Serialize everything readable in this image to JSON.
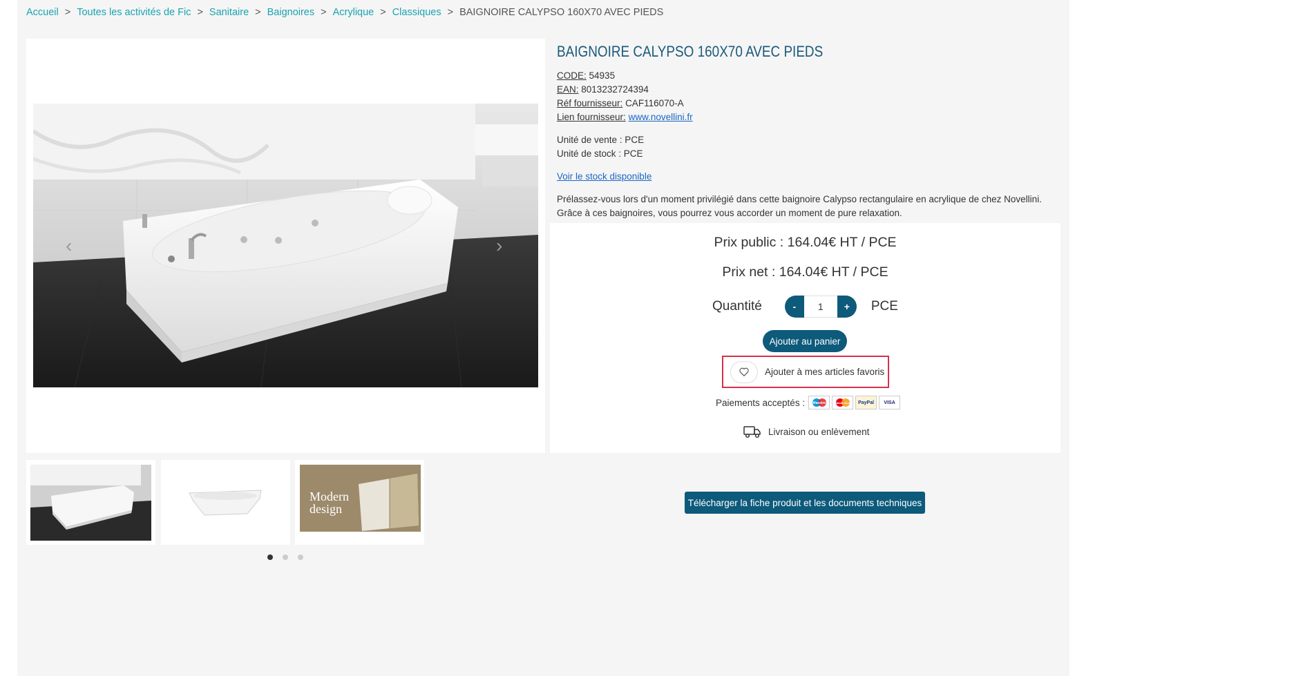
{
  "breadcrumb": {
    "items": [
      "Accueil",
      "Toutes les activités de Fic",
      "Sanitaire",
      "Baignoires",
      "Acrylique",
      "Classiques"
    ],
    "separator": ">",
    "current": "BAIGNOIRE CALYPSO 160X70 AVEC PIEDS"
  },
  "product": {
    "title": "BAIGNOIRE CALYPSO 160X70 AVEC PIEDS",
    "code_label": "CODE:",
    "code": "54935",
    "ean_label": "EAN:",
    "ean": "8013232724394",
    "ref_label": "Réf fournisseur:",
    "ref": "CAF116070-A",
    "link_label": "Lien fournisseur:",
    "link": "www.novellini.fr",
    "sale_unit": "Unité de vente : PCE",
    "stock_unit": "Unité de stock : PCE",
    "stock_link": "Voir le stock disponible",
    "description": "Prélassez-vous lors d'un moment privilégié dans cette baignoire Calypso rectangulaire en acrylique de chez Novellini. Grâce à ces baignoires, vous pourrez vous accorder un moment de pure relaxation."
  },
  "pricing": {
    "public_price": "Prix public : 164.04€ HT / PCE",
    "net_price": "Prix net : 164.04€ HT / PCE",
    "quantity_label": "Quantité",
    "quantity_value": "1",
    "minus": "-",
    "plus": "+",
    "unit": "PCE",
    "add_to_cart": "Ajouter au panier",
    "favorite": "Ajouter à mes articles favoris",
    "payments_label": "Paiements acceptés :",
    "cards": [
      "Maestro",
      "MasterCard",
      "PayPal",
      "VISA"
    ],
    "delivery": "Livraison ou enlèvement"
  },
  "gallery": {
    "thumb3_text": "Modern design",
    "dots": 3,
    "active_dot": 0
  },
  "download_button": "Télécharger la fiche produit et les documents techniques",
  "colors": {
    "accent": "#0d5a7b",
    "link": "#1aa3b0",
    "highlight": "#d6304b"
  }
}
